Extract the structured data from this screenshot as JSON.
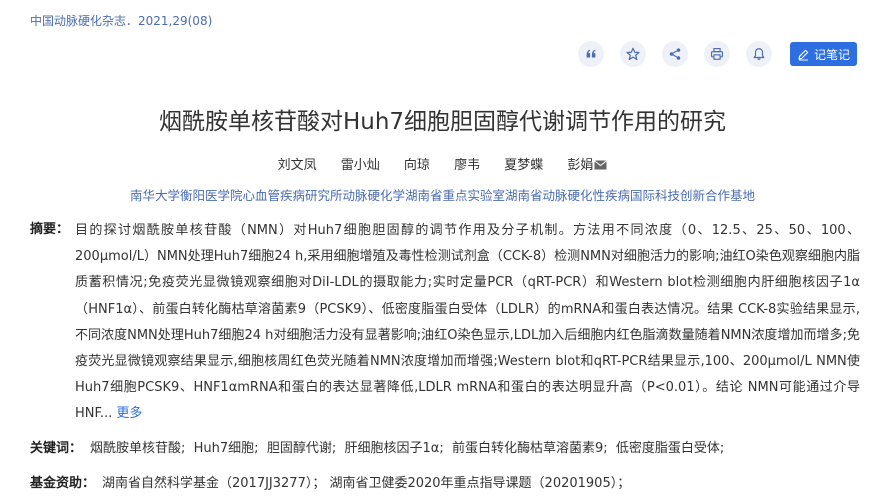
{
  "journal": "中国动脉硬化杂志．2021,29(08)",
  "toolbar": {
    "icons": [
      "quote-icon",
      "star-icon",
      "share-icon",
      "print-icon",
      "bell-icon"
    ],
    "note_label": "记笔记",
    "accent": "#2d6ee0"
  },
  "title": "烟酰胺单核苷酸对Huh7细胞胆固醇代谢调节作用的研究",
  "authors": [
    "刘文凤",
    "雷小灿",
    "向琼",
    "廖韦",
    "夏梦蝶",
    "彭娟"
  ],
  "affiliation": "南华大学衡阳医学院心血管疾病研究所动脉硬化学湖南省重点实验室湖南省动脉硬化性疾病国际科技创新合作基地",
  "abstract": {
    "label": "摘要：",
    "text": "目的探讨烟酰胺单核苷酸（NMN）对Huh7细胞胆固醇的调节作用及分子机制。方法用不同浓度（0、12.5、25、50、100、200μmol/L）NMN处理Huh7细胞24 h,采用细胞增殖及毒性检测试剂盒（CCK-8）检测NMN对细胞活力的影响;油红O染色观察细胞内脂质蓄积情况;免疫荧光显微镜观察细胞对DiI-LDL的摄取能力;实时定量PCR（qRT-PCR）和Western blot检测细胞内肝细胞核因子1α（HNF1α）、前蛋白转化酶枯草溶菌素9（PCSK9）、低密度脂蛋白受体（LDLR）的mRNA和蛋白表达情况。结果 CCK-8实验结果显示,不同浓度NMN处理Huh7细胞24 h对细胞活力没有显著影响;油红O染色显示,LDL加入后细胞内红色脂滴数量随着NMN浓度增加而增多;免疫荧光显微镜观察结果显示,细胞核周红色荧光随着NMN浓度增加而增强;Western blot和qRT-PCR结果显示,100、200μmol/L NMN使Huh7细胞PCSK9、HNF1αmRNA和蛋白的表达显著降低,LDLR mRNA和蛋白的表达明显升高（P<0.01）。结论 NMN可能通过介导HNF... ",
    "more": "更多"
  },
  "keywords": {
    "label": "关键词：",
    "items": [
      "烟酰胺单核苷酸;",
      "Huh7细胞;",
      "胆固醇代谢;",
      "肝细胞核因子1α;",
      "前蛋白转化酶枯草溶菌素9;",
      "低密度脂蛋白受体;"
    ]
  },
  "funds": {
    "label": "基金资助：",
    "text": "湖南省自然科学基金（2017JJ3277）； 湖南省卫健委2020年重点指导课题（20201905）；"
  }
}
